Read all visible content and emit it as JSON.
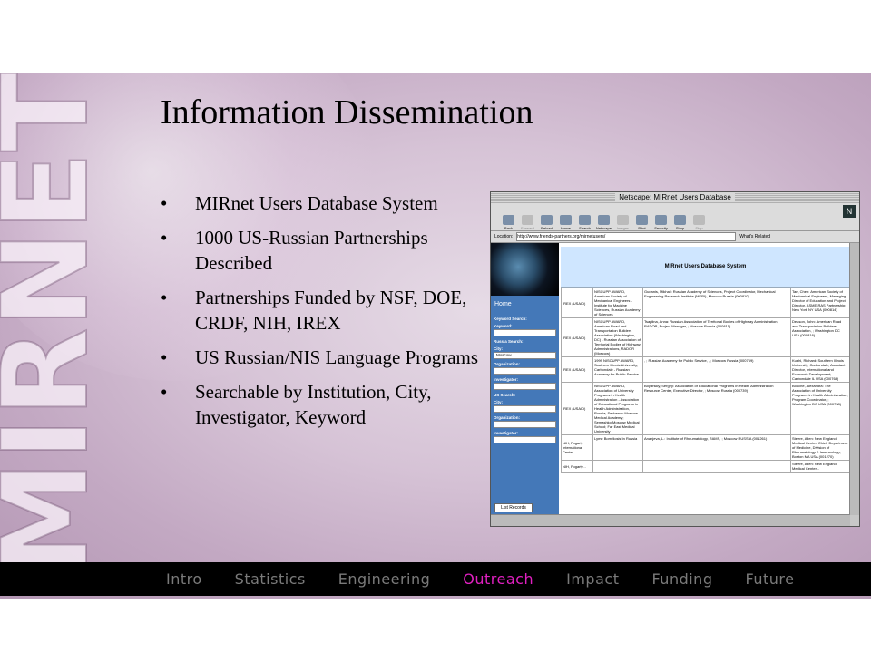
{
  "logo": {
    "text": "MIRNET"
  },
  "slide": {
    "title": "Information Dissemination",
    "bullet_symbol": "•",
    "bullets": [
      "MIRnet Users Database System",
      "1000 US-Russian Partnerships Described",
      "Partnerships Funded by NSF, DOE, CRDF, NIH, IREX",
      "US Russian/NIS Language Programs",
      "Searchable by Institution, City, Investigator, Keyword"
    ]
  },
  "browser": {
    "window_title": "Netscape: MIRnet Users Database",
    "toolbar": [
      "Back",
      "Forward",
      "Reload",
      "Home",
      "Search",
      "Netscape",
      "Images",
      "Print",
      "Security",
      "Shop",
      "Stop"
    ],
    "location_label": "Location:",
    "url": "http://www.friends-partners.org/mirnetusers/",
    "related_label": "What's Related",
    "sidebar": {
      "home": "Home",
      "keyword_search": "Keyword Search:",
      "keyword": "Keyword:",
      "russia_search": "Russia Search:",
      "city": "City:",
      "city_value": "Moscow",
      "organization": "Organization:",
      "investigator": "Investigator:",
      "us_search": "US Search:",
      "us_city": "City:",
      "us_organization": "Organization:",
      "us_investigator": "Investigator:",
      "list_records": "List Records"
    },
    "banner": "MIRnet Users Database System",
    "rows": [
      {
        "funder": "IREX (USAID)",
        "program": "NISCUPP AWARD, American Society of Mechanical Engineers - Institute for Machine Sciences, Russian Academy of Sciences",
        "russian": "Gudanis, Mikhail: Russian Academy of Sciences, Project Coordinator, Mechanical Engineering Research Institute (MERI), Moscow Russia (000810)",
        "us": "Tan, Chen: American Society of Mechanical Engineers, Managing Director of Education and Project Director, ASME-RAS Partnership; New York NY USA (000814)"
      },
      {
        "funder": "IREX (USAID)",
        "program": "NISCUPP AWARD, American Road and Transportation Builders Association (Washington, DC) - Russian Association of Territorial Bodies of Highway Administrations, RADOR (Moscow)",
        "russian": "Tsaplina, Anna: Russian Association of Territorial Bodies of Highway Administration, RADOR, Project Manager, ; Moscow Russia (000815)",
        "us": "Deason, John: American Road and Transportation Builders Association, ; Washington DC USA (000816)"
      },
      {
        "funder": "IREX (USAID)",
        "program": "1999 NISCUPP AWARD, Southern Illinois University, Carbondale - Russian Academy for Public Service",
        "russian": ", ; Russian Academy for Public Service, , ; Moscow Russia (000769)",
        "us": "Kuehl, Richard: Southern Illinois University, Carbondale, Assistant Director, International and Economic Development; Carbondale IL USA (000768)"
      },
      {
        "funder": "IREX (USAID)",
        "program": "NISCUPP AWARD, Association of University Programs in Health Administration - Association of Educational Programs in Health Administration, Russia; Sechenov Moscow Medical Academy; Semashko Moscow Medical School; Far East Medical University",
        "russian": "Boyarskiy, Sergey: Association of Educational Programs in Health Administration Resource Center, Executive Director, ; Moscow Russia (000739)",
        "us": "Bouche, Alexandra: The Association of University Programs in Health Administration, Program Coordinator, ; Washington DC USA (000738)"
      },
      {
        "funder": "NIH, Fogarty International Center",
        "program": "Lyme Borreliosis In Russia",
        "russian": "Ananjeva, L.: Institute of Rheumatology, RAMS, ; Moscow RUSSIA (001261)",
        "us": "Steere, Allen: New England Medical Center, Chief, Department of Medicine, Division of Rheumatology & Immunology; Boston MA USA (001270)"
      },
      {
        "funder": "NIH, Fogarty...",
        "program": "",
        "russian": "",
        "us": "Steere, Allen: New England Medical Center..."
      }
    ]
  },
  "nav": {
    "items": [
      "Intro",
      "Statistics",
      "Engineering",
      "Outreach",
      "Impact",
      "Funding",
      "Future"
    ],
    "active": "Outreach",
    "inactive_color": "#7a7a7a",
    "active_color": "#e020c0"
  }
}
